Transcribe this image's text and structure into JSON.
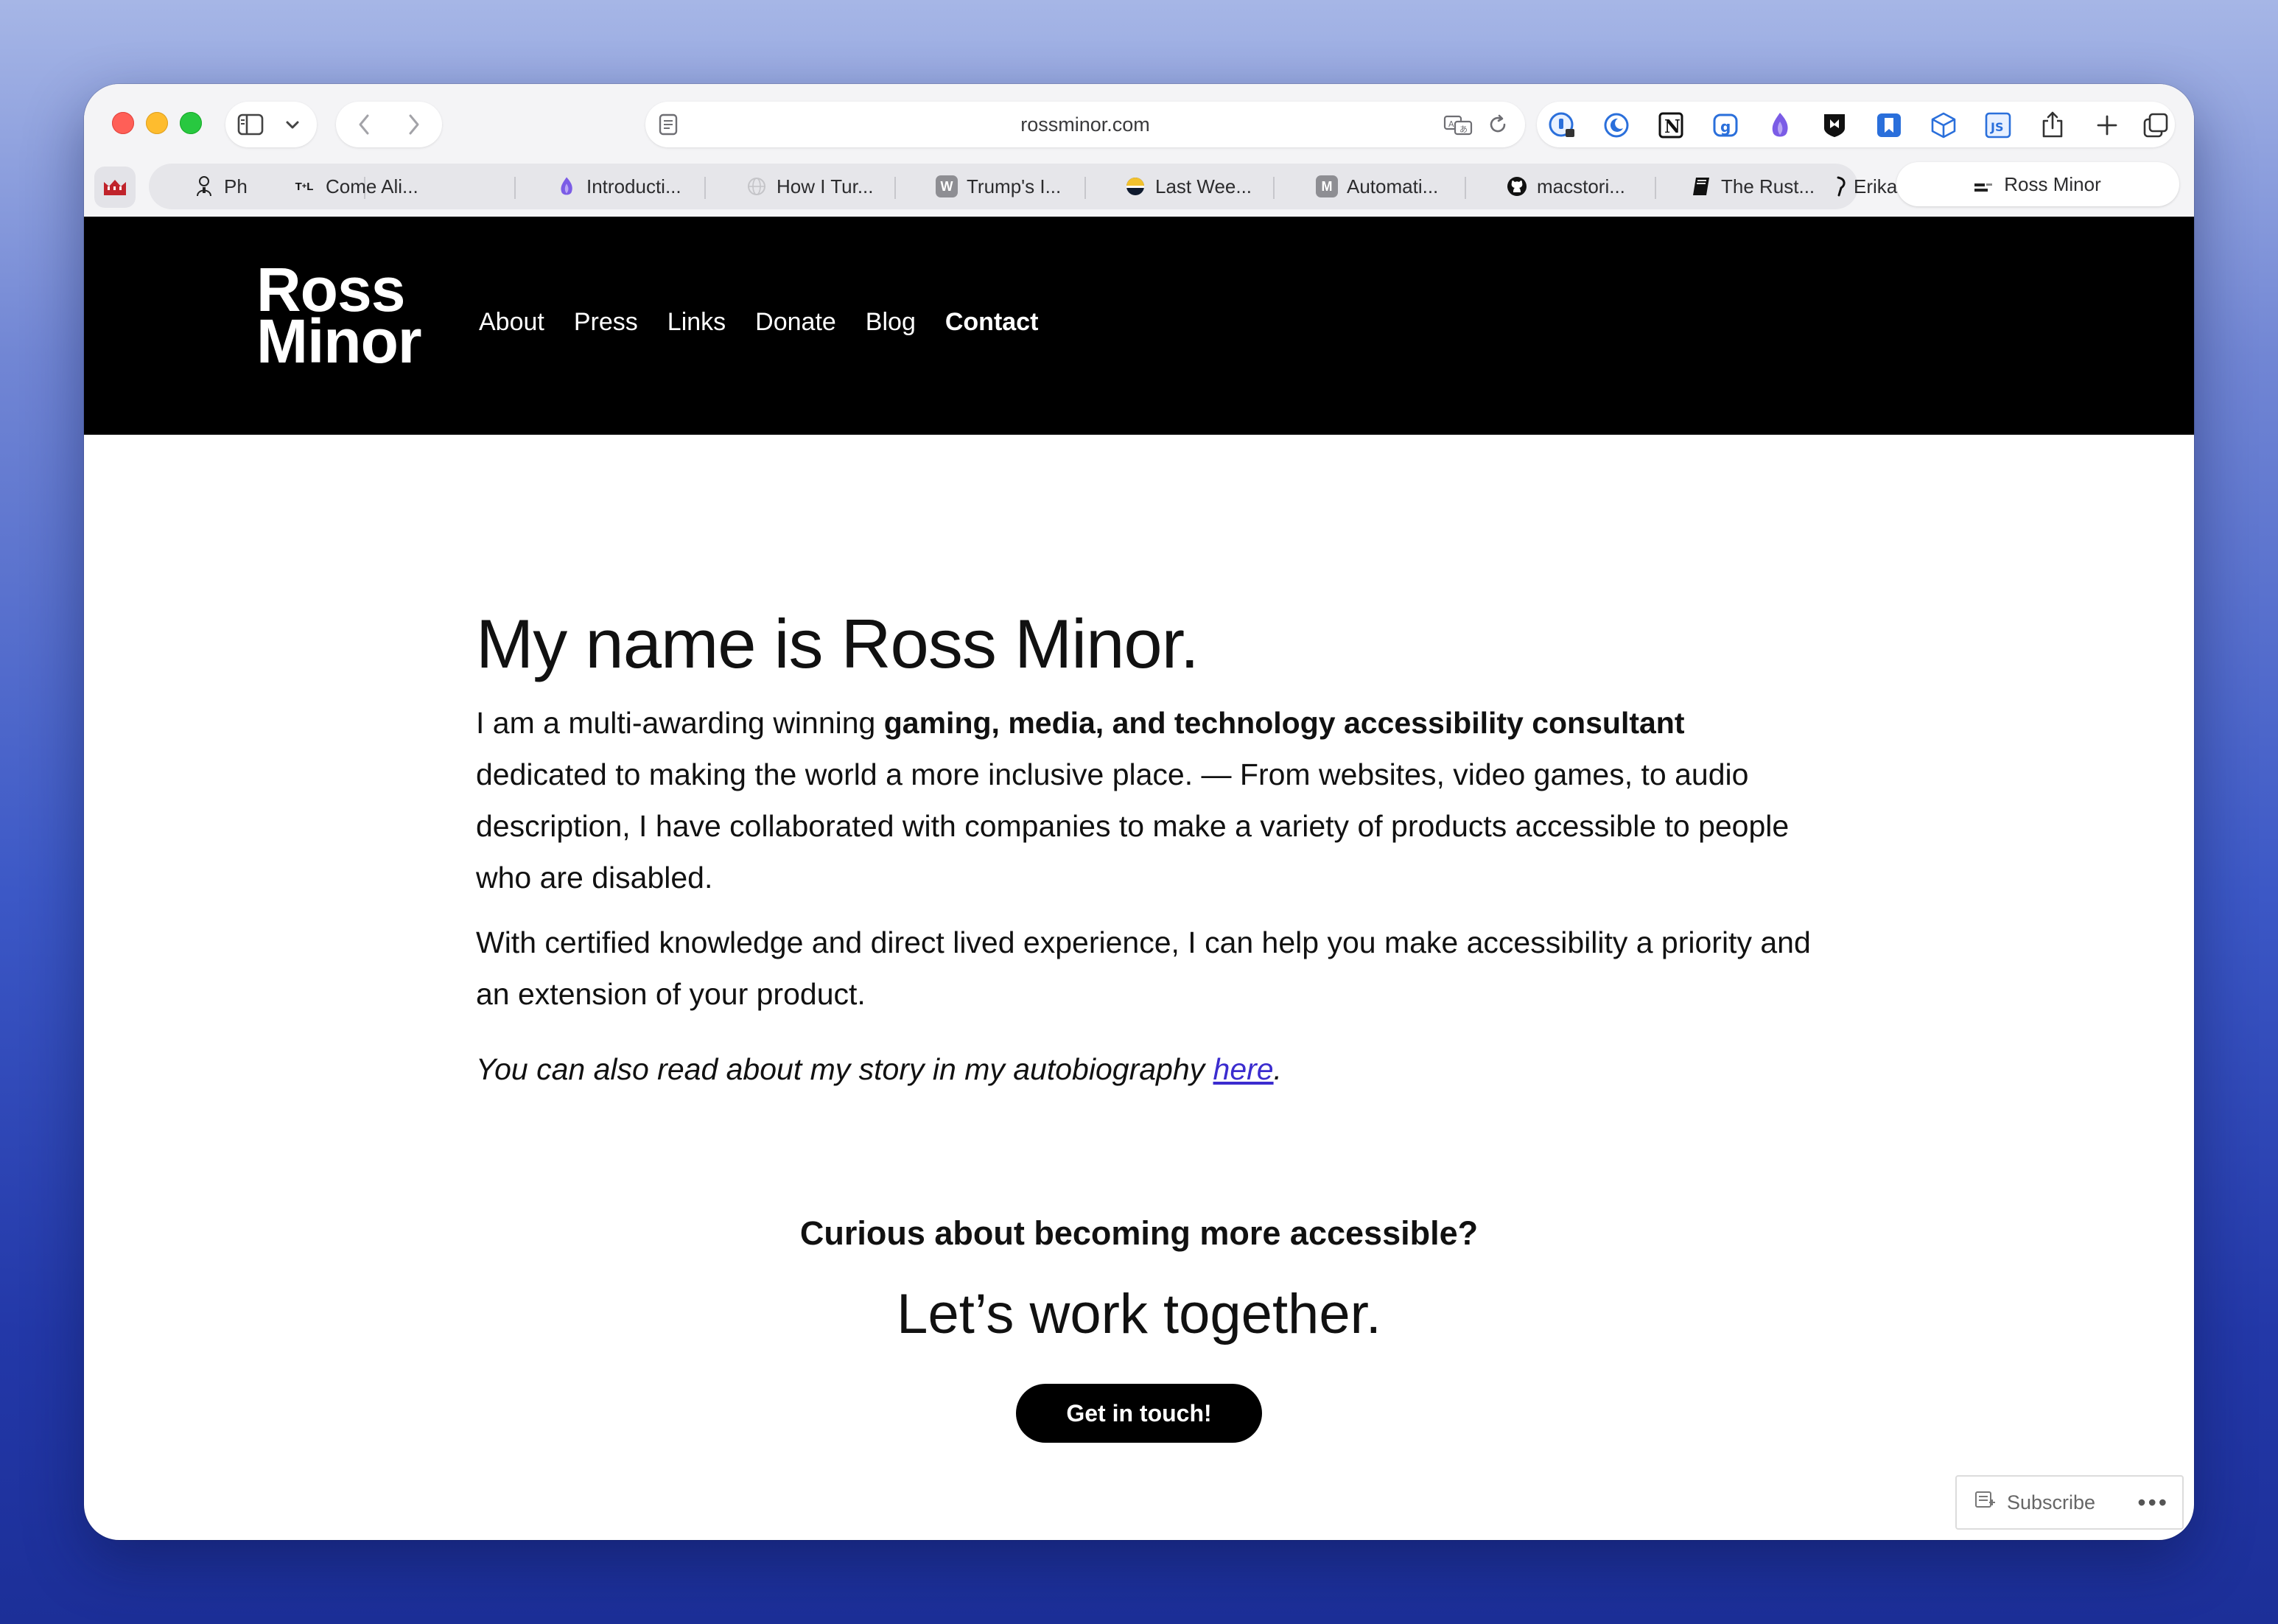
{
  "browser": {
    "address": "rossminor.com",
    "tabs": [
      {
        "label": "Ph",
        "icon": "person-sketch-icon"
      },
      {
        "label": "Come Ali...",
        "icon": "tl-favicon"
      },
      {
        "label": "Introducti...",
        "icon": "purple-flame-icon"
      },
      {
        "label": "How I Tur...",
        "icon": "globe-icon"
      },
      {
        "label": "Trump's I...",
        "icon": "w-favicon"
      },
      {
        "label": "Last Wee...",
        "icon": "half-circle-favicon"
      },
      {
        "label": "Automati...",
        "icon": "m-favicon"
      },
      {
        "label": "macstori...",
        "icon": "github-icon"
      },
      {
        "label": "The Rust...",
        "icon": "book-icon"
      },
      {
        "label": "Erika",
        "icon": "feather-icon"
      }
    ],
    "active_tab": "Ross Minor"
  },
  "site": {
    "logo_line1": "Ross",
    "logo_line2": "Minor",
    "nav": [
      "About",
      "Press",
      "Links",
      "Donate",
      "Blog",
      "Contact"
    ],
    "active_nav": "Contact"
  },
  "content": {
    "heading": "My name is Ross Minor.",
    "p1_pre": "I am a multi-awarding winning ",
    "p1_bold": "gaming, media, and technology accessibility consultant",
    "p1_post": " dedicated to making the world a more inclusive place. — From websites, video games, to audio description, I have collaborated with companies to make a variety of products accessible to people who are disabled.",
    "p2": "With certified knowledge and direct lived experience, I can help you make accessibility a priority and an extension of your product.",
    "p3_pre": "You can also read about my story in my autobiography ",
    "p3_link": "here",
    "p3_post": ".",
    "cta_question": "Curious about becoming more accessible?",
    "cta_heading": "Let’s work together.",
    "cta_button": "Get in touch!"
  },
  "subscribe": {
    "label": "Subscribe",
    "more": "•••"
  },
  "colors": {
    "header_bg": "#000000",
    "link": "#3b2ccf",
    "traffic_red": "#ff5f57",
    "traffic_yellow": "#febc2e",
    "traffic_green": "#28c840"
  }
}
